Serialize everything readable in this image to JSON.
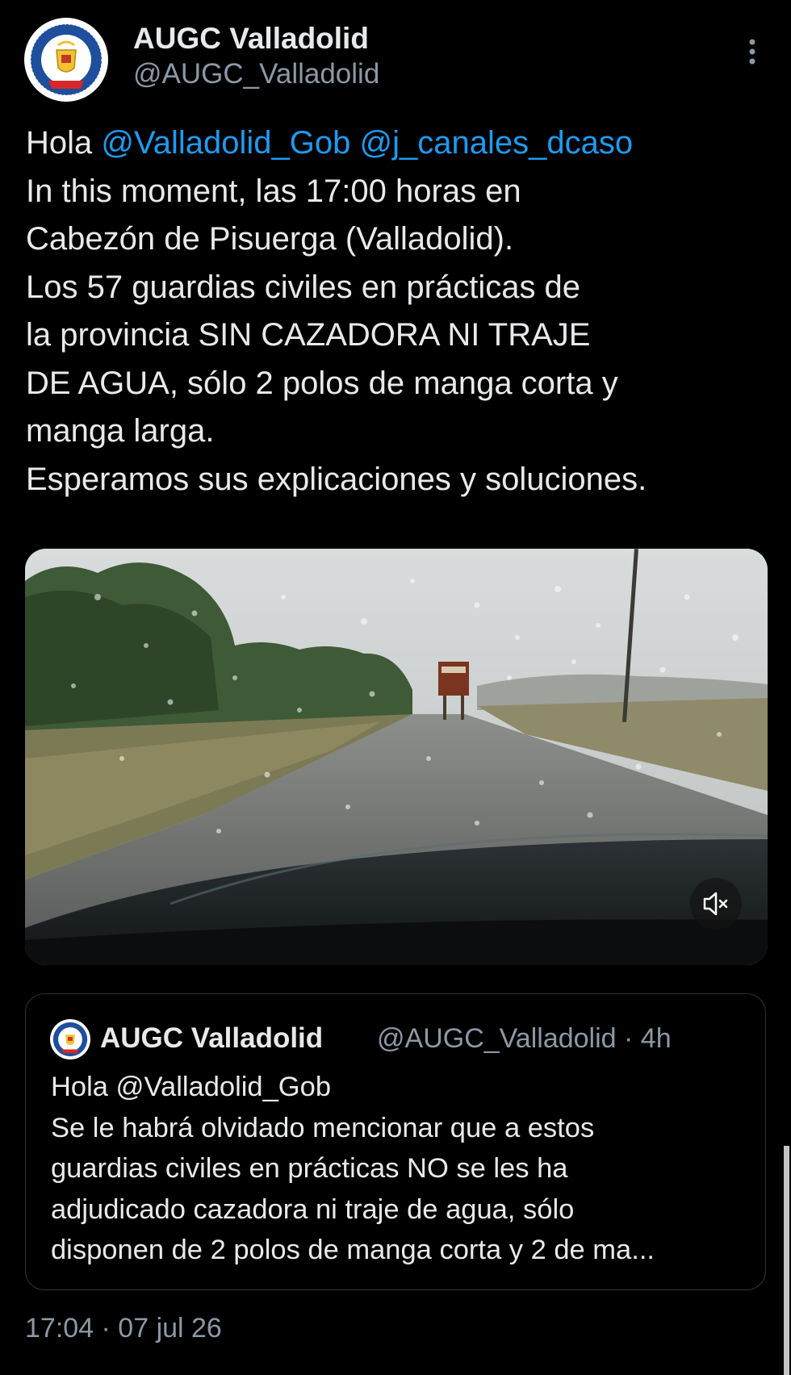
{
  "author": {
    "display_name": "AUGC Valladolid",
    "handle": "@AUGC_Valladolid",
    "avatar_icon": "augc-seal-logo",
    "avatar_logo_text": "ASOCIACIÓN UNIFICADA DE GUARDIAS CIVILES · VALLADOLID"
  },
  "menu": {
    "more_icon": "vertical-ellipsis-icon"
  },
  "tweet": {
    "greeting": "Hola ",
    "mention_1": "@Valladolid_Gob",
    "space": " ",
    "mention_2": "@j_canales_dcaso",
    "lines": [
      "In this moment, las 17:00 horas en",
      "Cabezón de Pisuerga (Valladolid).",
      "Los 57 guardias civiles en prácticas de",
      "la provincia SIN CAZADORA NI TRAJE",
      "DE AGUA, sólo 2 polos de manga corta y",
      "manga larga.",
      "Esperamos sus explicaciones y soluciones."
    ]
  },
  "media": {
    "type": "video",
    "content": "rainy road seen through car windshield",
    "mute_icon": "speaker-muted-icon"
  },
  "quote": {
    "display_name": "AUGC Valladolid",
    "meta": "@AUGC_Valladolid · 4h",
    "lines": [
      "Hola @Valladolid_Gob",
      "Se le habrá olvidado mencionar que a estos",
      "guardias civiles en prácticas NO se les ha",
      "adjudicado cazadora ni traje de agua, sólo",
      "disponen de 2 polos de manga corta y 2 de ma..."
    ]
  },
  "timestamp": "17:04 · 07 jul 26",
  "colors": {
    "background": "#000000",
    "text": "#e7e9ea",
    "secondary_text": "#8b98a5",
    "link": "#1d9bf0",
    "border": "#2f3336"
  }
}
